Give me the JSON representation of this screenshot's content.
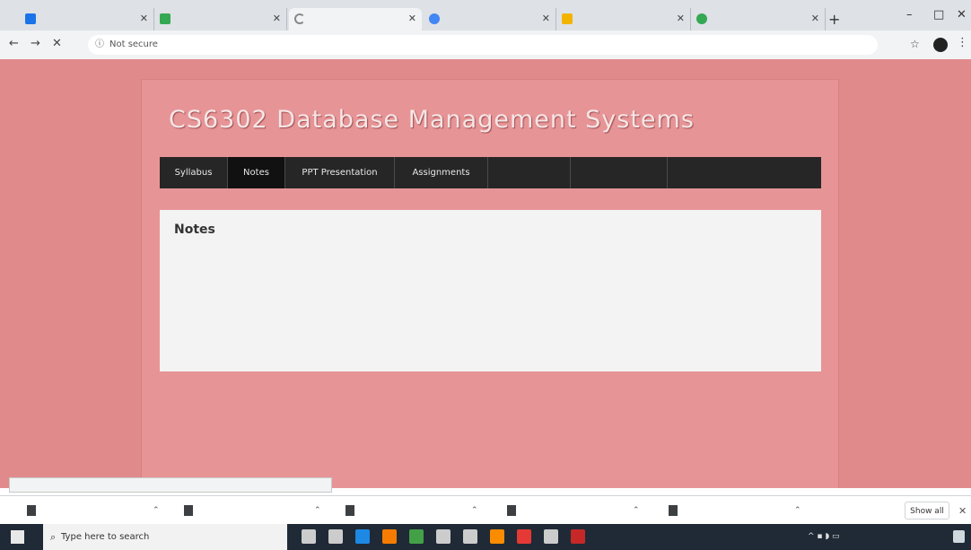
{
  "browser": {
    "tabs": [
      {
        "title": "",
        "active": false,
        "favicon_color": "#1a73e8"
      },
      {
        "title": "",
        "active": false,
        "favicon_color": "#34a853"
      },
      {
        "title": "",
        "active": true,
        "favicon_color": "#888888"
      },
      {
        "title": "",
        "active": false,
        "favicon_color": "#4285f4"
      },
      {
        "title": "",
        "active": false,
        "favicon_color": "#f2b400"
      },
      {
        "title": "",
        "active": false,
        "favicon_color": "#34a853"
      }
    ],
    "new_tab_glyph": "+",
    "window_controls": [
      "–",
      "□",
      "✕"
    ],
    "nav_glyphs": [
      "←",
      "→",
      "✕"
    ],
    "address_security": "Not secure",
    "address_url": ""
  },
  "site": {
    "title": "CS6302 Database Management Systems",
    "menu": [
      {
        "label": "Syllabus",
        "active": false
      },
      {
        "label": "Notes",
        "active": true
      },
      {
        "label": "PPT Presentation",
        "active": false
      },
      {
        "label": "Assignments",
        "active": false
      },
      {
        "label": "",
        "active": false
      },
      {
        "label": "",
        "active": false
      },
      {
        "label": "",
        "active": false
      }
    ],
    "content_heading": "Notes",
    "notes": [
      "",
      "",
      ""
    ],
    "footer_link": "",
    "subscribe": "",
    "attribution": ""
  },
  "status_bubble": "",
  "downloads": {
    "items": [
      "",
      "",
      "",
      "",
      ""
    ],
    "show_all": "Show all"
  },
  "taskbar": {
    "search_placeholder": "Type here to search",
    "clock": "",
    "icon_colors": [
      "#cccccc",
      "#cccccc",
      "#1e88e5",
      "#f57c00",
      "#43a047",
      "#cccccc",
      "#cccccc",
      "#fb8c00",
      "#e53935",
      "#cccccc",
      "#c62828"
    ]
  },
  "colors": {
    "page_background": "#e18a8c",
    "menu_background": "#262626",
    "content_background": "#f3f3f3"
  }
}
